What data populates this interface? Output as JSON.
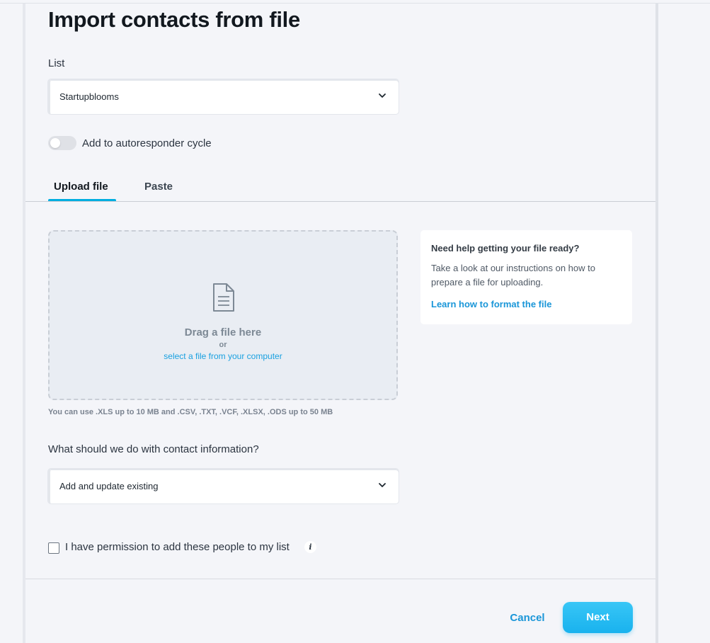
{
  "page": {
    "title": "Import contacts from file"
  },
  "list_field": {
    "label": "List",
    "value": "Startupblooms"
  },
  "autoresponder": {
    "label": "Add to autoresponder cycle",
    "enabled": false
  },
  "tabs": [
    {
      "label": "Upload file",
      "active": true
    },
    {
      "label": "Paste",
      "active": false
    }
  ],
  "dropzone": {
    "title": "Drag a file here",
    "or": "or",
    "link": "select a file from your computer",
    "hint": "You can use .XLS up to 10 MB and .CSV, .TXT, .VCF, .XLSX, .ODS up to 50 MB"
  },
  "help": {
    "title": "Need help getting your file ready?",
    "body": "Take a look at our instructions on how to prepare a file for uploading.",
    "link": "Learn how to format the file"
  },
  "contact_info_field": {
    "label": "What should we do with contact information?",
    "value": "Add and update existing"
  },
  "permission": {
    "label": "I have permission to add these people to my list",
    "checked": false,
    "info_glyph": "i"
  },
  "footer": {
    "cancel": "Cancel",
    "next": "Next"
  },
  "colors": {
    "accent": "#00aee0",
    "link": "#1a96d8",
    "next_button": "#19b2ee"
  }
}
